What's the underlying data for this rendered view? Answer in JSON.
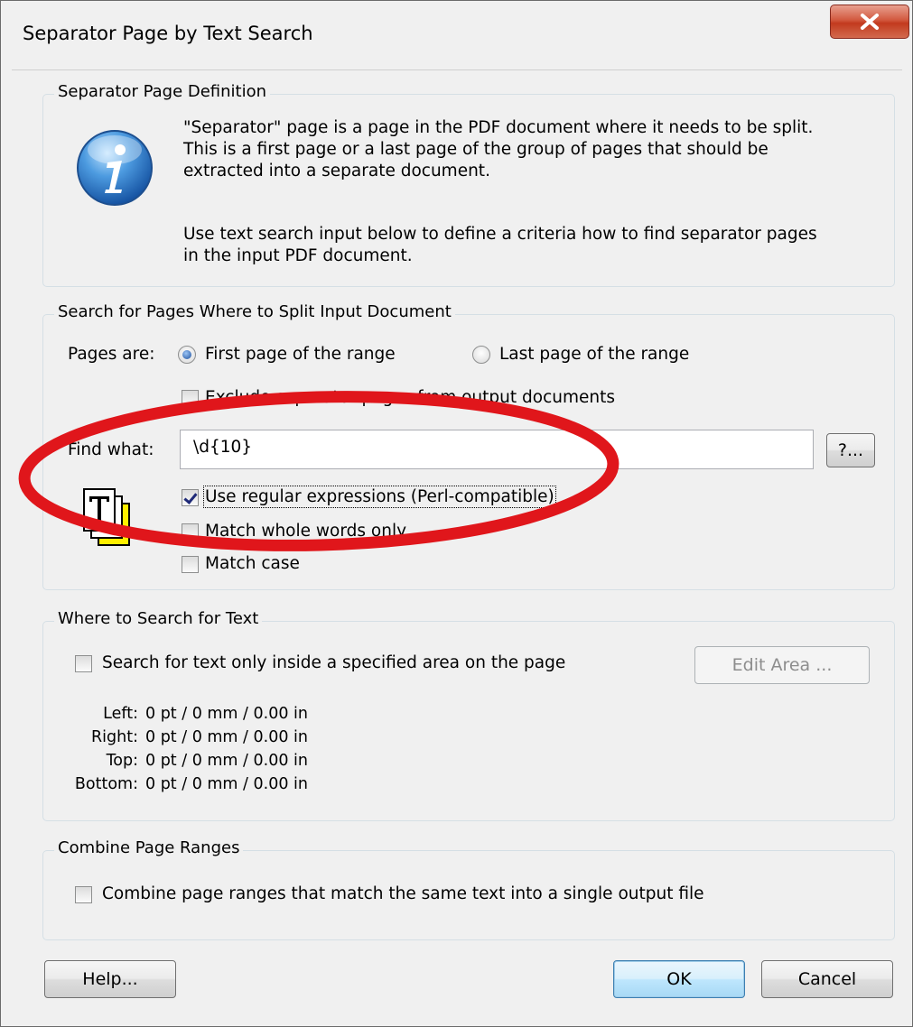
{
  "window": {
    "title": "Separator Page by Text Search"
  },
  "definition_group": {
    "label": "Separator Page Definition",
    "icon": "info-icon",
    "paragraph1_lines": [
      "\"Separator\" page is a page in the PDF document where it needs to be split.",
      "This is a first page or a last page of the group of pages that should be",
      "extracted into a separate document."
    ],
    "paragraph2_lines": [
      "Use text search input below to define a criteria how to find separator pages",
      "in the input PDF document."
    ]
  },
  "search_group": {
    "label": "Search for Pages Where to Split Input Document",
    "pages_are_label": "Pages are:",
    "radio_first_label": "First page of the range",
    "radio_last_label": "Last page of the range",
    "radio_selected": "first",
    "exclude_label": "Exclude separator pages from output documents",
    "exclude_checked": false,
    "find_what_label": "Find what:",
    "find_what_value": "\\d{10}",
    "help_button_label": "?...",
    "use_regex_label": "Use regular expressions (Perl-compatible)",
    "use_regex_checked": true,
    "whole_words_label": "Match whole words only",
    "whole_words_checked": false,
    "match_case_label": "Match case",
    "match_case_checked": false,
    "icon": "text-find-icon",
    "highlight_color": "#e0161b"
  },
  "where_group": {
    "label": "Where to Search for Text",
    "area_checkbox_label": "Search for text only inside a specified area on the page",
    "area_checked": false,
    "edit_area_button": "Edit Area ...",
    "left_label": "Left:",
    "left_value": "0 pt / 0 mm / 0.00 in",
    "right_label": "Right:",
    "right_value": "0 pt / 0 mm / 0.00 in",
    "top_label": "Top:",
    "top_value": "0 pt / 0 mm / 0.00 in",
    "bottom_label": "Bottom:",
    "bottom_value": "0 pt / 0 mm / 0.00 in"
  },
  "combine_group": {
    "label": "Combine Page Ranges",
    "combine_checkbox_label": "Combine page ranges that match the same text into a single output file",
    "combine_checked": false
  },
  "footer": {
    "help_button": "Help...",
    "ok_button": "OK",
    "cancel_button": "Cancel"
  }
}
